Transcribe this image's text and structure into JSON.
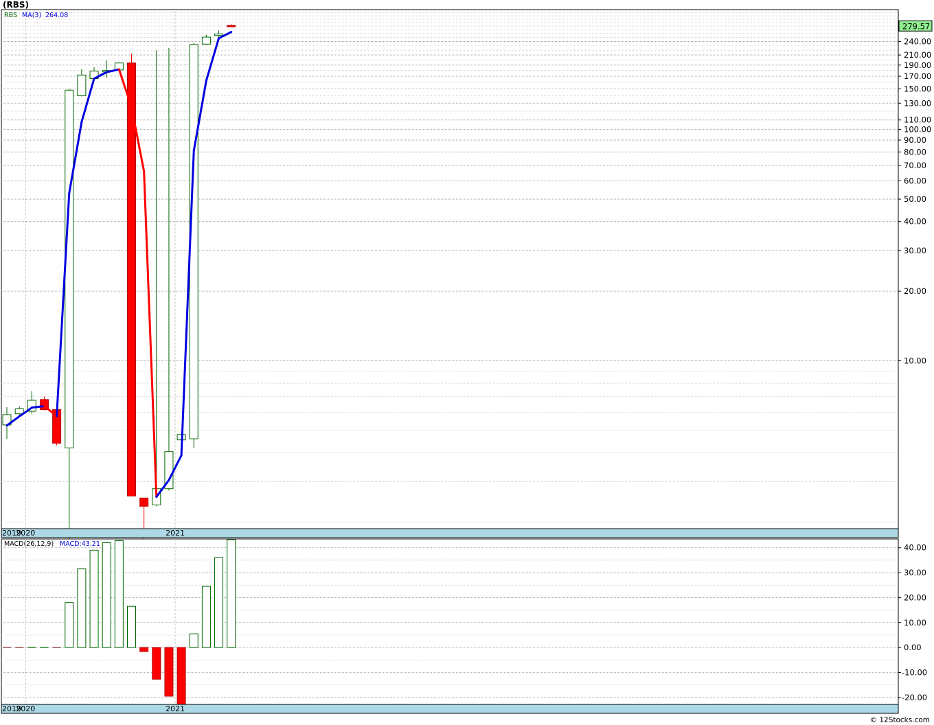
{
  "header": {
    "title": "(RBS)"
  },
  "credit": "© 12Stocks.com",
  "colors": {
    "up": "#006400",
    "down": "#ff0000",
    "ma_up": "#0000e0",
    "ma_down": "#ff0000",
    "axis_band": "#add8e6",
    "last_box": "#90ee90",
    "grid": "#a0a0a0"
  },
  "chart_data": [
    {
      "type": "candlestick",
      "title": "",
      "scale": "log",
      "legend": {
        "symbol": "RBS",
        "ma_label": "MA(3)",
        "ma_value": "264.08"
      },
      "last_value_label": "279.57",
      "last_value": 279.57,
      "y_tick_labels": [
        "240.00",
        "210.00",
        "190.00",
        "170.00",
        "150.00",
        "130.00",
        "110.00",
        "100.00",
        "90.00",
        "80.00",
        "70.00",
        "60.00",
        "50.00",
        "40.00",
        "30.00",
        "20.00",
        "10.00"
      ],
      "y_ticks": [
        240,
        210,
        190,
        170,
        150,
        130,
        110,
        100,
        90,
        80,
        70,
        60,
        50,
        40,
        30,
        20,
        10
      ],
      "x_tick_labels": [
        "2019",
        "2020",
        "2021"
      ],
      "x_tick_months": [
        -1,
        1,
        13
      ],
      "ylim": [
        1.88,
        330
      ],
      "ma_period": 3,
      "candles": [
        {
          "m": -1,
          "o": 5.28,
          "h": 6.3,
          "l": 4.6,
          "c": 5.85
        },
        {
          "m": 0,
          "o": 5.9,
          "h": 6.35,
          "l": 5.7,
          "c": 6.2
        },
        {
          "m": 1,
          "o": 6.05,
          "h": 7.4,
          "l": 5.9,
          "c": 6.75
        },
        {
          "m": 2,
          "o": 6.8,
          "h": 7.0,
          "l": 6.1,
          "c": 6.15
        },
        {
          "m": 3,
          "o": 6.15,
          "h": 6.25,
          "l": 4.3,
          "c": 4.4
        },
        {
          "m": 4,
          "o": 4.2,
          "h": 150,
          "l": 1.7,
          "c": 148
        },
        {
          "m": 5,
          "o": 140,
          "h": 182,
          "l": 139,
          "c": 172
        },
        {
          "m": 6,
          "o": 166,
          "h": 186,
          "l": 165,
          "c": 179
        },
        {
          "m": 7,
          "o": 180,
          "h": 199,
          "l": 168,
          "c": 180
        },
        {
          "m": 8,
          "o": 181,
          "h": 195,
          "l": 177,
          "c": 194
        },
        {
          "m": 9,
          "o": 194,
          "h": 213,
          "l": 2.6,
          "c": 2.6
        },
        {
          "m": 10,
          "o": 2.55,
          "h": 2.56,
          "l": 1.7,
          "c": 2.35
        },
        {
          "m": 11,
          "o": 2.38,
          "h": 220,
          "l": 2.35,
          "c": 2.8
        },
        {
          "m": 12,
          "o": 2.8,
          "h": 225,
          "l": 2.75,
          "c": 4.05
        },
        {
          "m": 13,
          "o": 4.55,
          "h": 4.9,
          "l": 4.5,
          "c": 4.8
        },
        {
          "m": 14,
          "o": 4.6,
          "h": 237,
          "l": 4.2,
          "c": 233
        },
        {
          "m": 15,
          "o": 234,
          "h": 257,
          "l": 233,
          "c": 251
        },
        {
          "m": 16,
          "o": 255,
          "h": 268,
          "l": 251,
          "c": 259
        },
        {
          "m": 17,
          "o": 282,
          "h": 285,
          "l": 279,
          "c": 279.57
        }
      ],
      "ma_values": [
        {
          "m": -1,
          "v": 5.25
        },
        {
          "m": 0,
          "v": 5.75
        },
        {
          "m": 1,
          "v": 6.27
        },
        {
          "m": 2,
          "v": 6.37
        },
        {
          "m": 3,
          "v": 5.77
        },
        {
          "m": 4,
          "v": 53
        },
        {
          "m": 5,
          "v": 108
        },
        {
          "m": 6,
          "v": 166
        },
        {
          "m": 7,
          "v": 177
        },
        {
          "m": 8,
          "v": 182
        },
        {
          "m": 9,
          "v": 125
        },
        {
          "m": 10,
          "v": 66
        },
        {
          "m": 11,
          "v": 2.58
        },
        {
          "m": 12,
          "v": 3.05
        },
        {
          "m": 13,
          "v": 3.9
        },
        {
          "m": 14,
          "v": 81
        },
        {
          "m": 15,
          "v": 163
        },
        {
          "m": 16,
          "v": 248
        },
        {
          "m": 17,
          "v": 264.08
        }
      ]
    },
    {
      "type": "bar",
      "title": "",
      "legend": {
        "label": "MACD(26,12,9)",
        "value_label": "MACD:43.21"
      },
      "y_tick_labels": [
        "40.00",
        "30.00",
        "20.00",
        "10.00",
        "0.00",
        "-10.00",
        "-20.00"
      ],
      "y_ticks": [
        40,
        30,
        20,
        10,
        0,
        -10,
        -20
      ],
      "x_tick_labels": [
        "2019",
        "2020",
        "2021"
      ],
      "x_tick_months": [
        -1,
        1,
        13
      ],
      "ylim": [
        -22.8,
        43.5
      ],
      "values": [
        {
          "m": -1,
          "v": 0
        },
        {
          "m": 0,
          "v": 0
        },
        {
          "m": 1,
          "v": 0.1
        },
        {
          "m": 2,
          "v": 0.1
        },
        {
          "m": 3,
          "v": 0
        },
        {
          "m": 4,
          "v": 18
        },
        {
          "m": 5,
          "v": 31.5
        },
        {
          "m": 6,
          "v": 39
        },
        {
          "m": 7,
          "v": 42
        },
        {
          "m": 8,
          "v": 42.8
        },
        {
          "m": 9,
          "v": 16.5
        },
        {
          "m": 10,
          "v": -1.6
        },
        {
          "m": 11,
          "v": -12.7
        },
        {
          "m": 12,
          "v": -19.5
        },
        {
          "m": 13,
          "v": -22.8
        },
        {
          "m": 14,
          "v": 5.5
        },
        {
          "m": 15,
          "v": 24.5
        },
        {
          "m": 16,
          "v": 36
        },
        {
          "m": 17,
          "v": 43.21
        }
      ]
    }
  ]
}
